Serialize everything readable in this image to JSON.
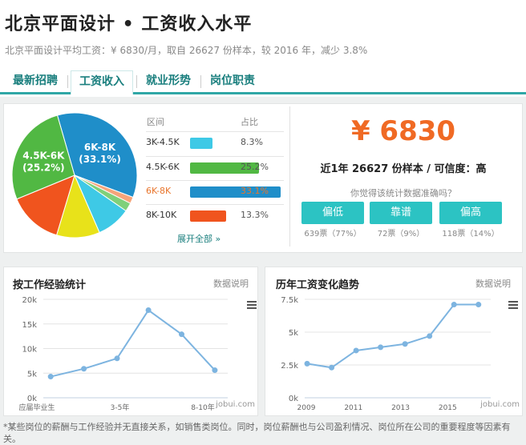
{
  "header": {
    "title": "北京平面设计 • 工资收入水平",
    "subtitle": "北京平面设计平均工资：¥ 6830/月，取自 26627 份样本，较 2016 年，减少 3.8%"
  },
  "tabs": [
    {
      "label": "最新招聘"
    },
    {
      "label": "工资收入",
      "active": true
    },
    {
      "label": "就业形势"
    },
    {
      "label": "岗位职责"
    }
  ],
  "distribution": {
    "col_range": "区间",
    "col_ratio": "占比",
    "rows": [
      {
        "range": "3K-4.5K",
        "pct": "8.3%",
        "value": 8.3,
        "color": "#3ec9e6"
      },
      {
        "range": "4.5K-6K",
        "pct": "25.2%",
        "value": 25.2,
        "color": "#51b843"
      },
      {
        "range": "6K-8K",
        "pct": "33.1%",
        "value": 33.1,
        "color": "#1f8ec9",
        "highlight": true
      },
      {
        "range": "8K-10K",
        "pct": "13.3%",
        "value": 13.3,
        "color": "#f0541e"
      }
    ],
    "expand": "展开全部 »"
  },
  "pie": {
    "slices": [
      {
        "value": 33.1,
        "color": "#1f8ec9",
        "label": "6K-8K",
        "pct": "(33.1%)"
      },
      {
        "value": 1.6,
        "color": "#f5a47a",
        "label": "",
        "pct": ""
      },
      {
        "value": 2.1,
        "color": "#7fd07a",
        "label": "",
        "pct": ""
      },
      {
        "value": 8.3,
        "color": "#3ec9e6",
        "label": "",
        "pct": ""
      },
      {
        "value": 10.5,
        "color": "#e8e21a",
        "label": "",
        "pct": ""
      },
      {
        "value": 13.3,
        "color": "#f0541e",
        "label": "",
        "pct": ""
      },
      {
        "value": 25.2,
        "color": "#51b843",
        "label": "4.5K-6K",
        "pct": "(25.2%)"
      }
    ]
  },
  "summary": {
    "salary": "¥ 6830",
    "desc": "近1年 26627 份样本 / 可信度：高",
    "question": "你觉得该统计数据准确吗？",
    "votes": [
      {
        "label": "偏低",
        "count": "639票（77%）"
      },
      {
        "label": "靠谱",
        "count": "72票（9%）"
      },
      {
        "label": "偏高",
        "count": "118票（14%）"
      }
    ]
  },
  "chart_data": [
    {
      "type": "line",
      "title": "按工作经验统计",
      "note": "数据说明",
      "watermark": "jobui.com",
      "ylim": [
        0,
        20000
      ],
      "yticks": [
        "0k",
        "5k",
        "10k",
        "15k",
        "20k"
      ],
      "xlabels": [
        "应届毕业生",
        "3-5年",
        "8-10年"
      ],
      "values": [
        4300,
        5900,
        8000,
        17800,
        12900,
        5600
      ],
      "color": "#7db4e0"
    },
    {
      "type": "line",
      "title": "历年工资变化趋势",
      "note": "数据说明",
      "watermark": "jobui.com",
      "ylim": [
        0,
        7500
      ],
      "yticks": [
        "0k",
        "2.5k",
        "5k",
        "7.5k"
      ],
      "xlabels": [
        "2009",
        "2011",
        "2013",
        "2015"
      ],
      "x": [
        2009,
        2010,
        2011,
        2012,
        2013,
        2014,
        2015,
        2016
      ],
      "values": [
        2600,
        2300,
        3600,
        3850,
        4100,
        4700,
        7100,
        7100
      ],
      "color": "#7db4e0"
    }
  ],
  "footnote": "*某些岗位的薪酬与工作经验并无直接关系，如销售类岗位。同时，岗位薪酬也与公司盈利情况、岗位所在公司的重要程度等因素有关。"
}
